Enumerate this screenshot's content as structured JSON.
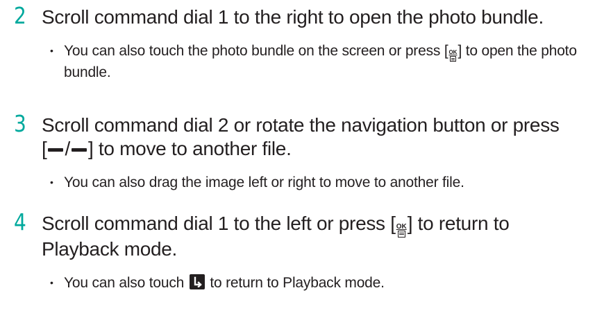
{
  "steps": [
    {
      "number": "2",
      "text": "Scroll command dial 1 to the right to open the photo bundle.",
      "bullet": {
        "before": "You can also touch the photo bundle on the screen or press [",
        "after": "] to open the photo bundle."
      }
    },
    {
      "number": "3",
      "line1": "Scroll command dial 2 or rotate the navigation button or press",
      "line2_open": "[",
      "line2_sep": "/",
      "line2_after": "] to move to another file.",
      "bullet": {
        "text": "You can also drag the image left or right to move to another file."
      }
    },
    {
      "number": "4",
      "before": "Scroll command dial 1 to the left or press [",
      "after": "] to return to Playback mode.",
      "bullet": {
        "before": "You can also touch ",
        "after": " to return to Playback mode."
      }
    }
  ],
  "icons": {
    "ok_key_label": "OK",
    "ok_key": "ok-menu-key-icon",
    "left_key": "left-key-icon",
    "right_key": "right-key-icon",
    "return": "return-icon"
  },
  "colors": {
    "step_number": "#00a99d",
    "text": "#231f20"
  }
}
